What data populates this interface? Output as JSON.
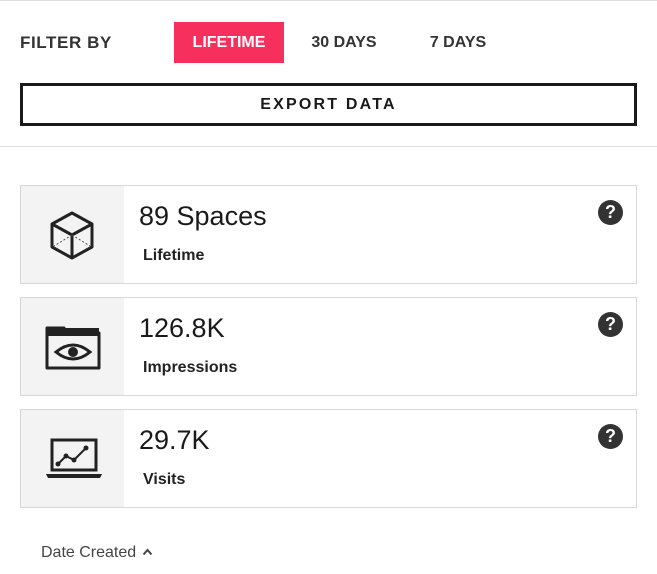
{
  "filter": {
    "label": "FILTER BY",
    "options": [
      {
        "label": "LIFETIME",
        "active": true
      },
      {
        "label": "30 DAYS",
        "active": false
      },
      {
        "label": "7 DAYS",
        "active": false
      }
    ],
    "active_color": "#f72f5c"
  },
  "export": {
    "label": "EXPORT DATA"
  },
  "stats": [
    {
      "value": "89 Spaces",
      "label": "Lifetime",
      "icon": "cube-icon",
      "help": "?"
    },
    {
      "value": "126.8K",
      "label": "Impressions",
      "icon": "folder-eye-icon",
      "help": "?"
    },
    {
      "value": "29.7K",
      "label": "Visits",
      "icon": "laptop-chart-icon",
      "help": "?"
    }
  ],
  "sort": {
    "label": "Date Created",
    "icon": "chevron-up-icon"
  }
}
